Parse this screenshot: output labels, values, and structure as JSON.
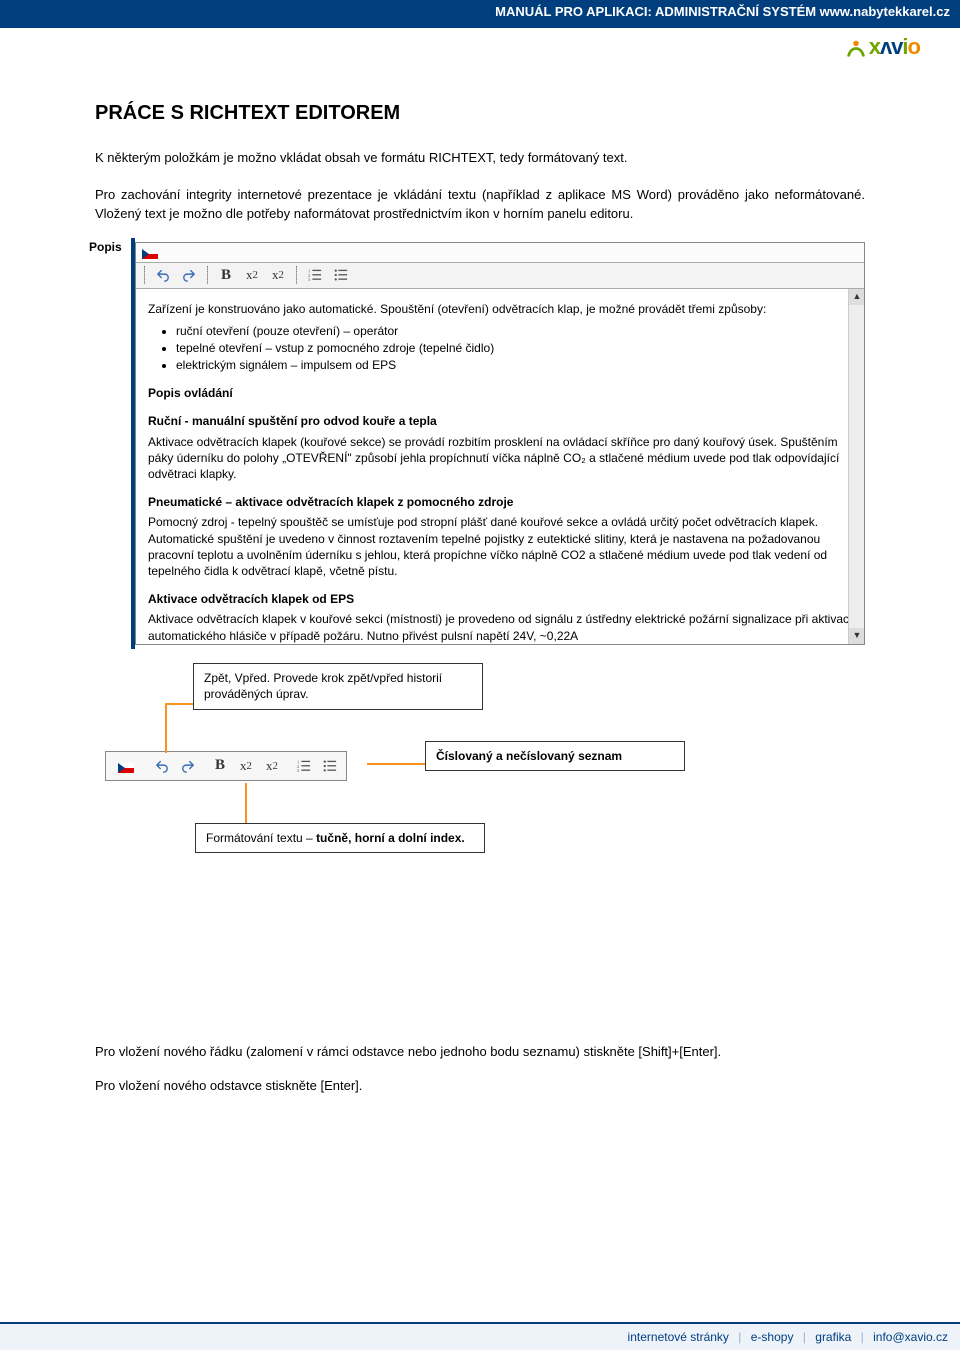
{
  "header": {
    "prefix": "MANUÁL PRO APLIKACI:",
    "title": "ADMINISTRAČNÍ SYSTÉM www.nabytekkarel.cz"
  },
  "brand": "xavio",
  "h1": "PRÁCE S RICHTEXT EDITOREM",
  "intro1": "K některým položkám je možno vkládat obsah ve formátu RICHTEXT, tedy formátovaný text.",
  "intro2": "Pro zachování integrity internetové prezentace je vkládání textu (například z aplikace MS Word) prováděno jako neformátované. Vložený text je možno dle potřeby naformátovat prostřednictvím ikon v horním panelu editoru.",
  "editor": {
    "popis_label": "Popis",
    "p0": "Zařízení je konstruováno jako automatické. Spouštění (otevření) odvětracích klap, je možné provádět třemi způsoby:",
    "li1": "ruční otevření (pouze otevření) – operátor",
    "li2": "tepelné otevření – vstup z pomocného zdroje (tepelné čidlo)",
    "li3": "elektrickým signálem – impulsem od EPS",
    "h_ovl": "Popis ovládání",
    "h_rucni": "Ruční - manuální spuštění pro odvod kouře a tepla",
    "p_rucni": "Aktivace odvětracích klapek (kouřové sekce) se provádí rozbitím prosklení na ovládací skříňce pro daný kouřový úsek. Spuštěním páky úderníku do polohy „OTEVŘENÍ\" způsobí jehla propíchnutí víčka náplně CO₂ a stlačené médium uvede pod tlak odpovídající odvětraci klapky.",
    "h_pneu": "Pneumatické – aktivace odvětracích klapek z pomocného zdroje",
    "p_pneu": "Pomocný zdroj - tepelný spouštěč se umísťuje pod stropní plášť dané kouřové sekce a ovládá určitý počet odvětracích klapek. Automatické spuštění je uvedeno v činnost roztavením tepelné pojistky z eutektické slitiny, která je nastavena na požadovanou pracovní teplotu a uvolněním úderníku s jehlou, která propíchne víčko náplně CO2 a stlačené médium uvede pod tlak vedení od tepelného čidla k odvětrací klapě, včetně pístu.",
    "h_eps": "Aktivace odvětracích klapek od EPS",
    "p_eps": "Aktivace odvětracích klapek v kouřové sekci (místnosti) je provedeno od signálu z ústředny elektrické požární signalizace při aktivaci automatického hlásiče v případě požáru. Nutno přivést pulsní napětí 24V, ~0,22A"
  },
  "annot": {
    "undo": "Zpět, Vpřed. Provede krok zpět/vpřed historií prováděných úprav.",
    "lists": "Číslovaný a nečíslovaný seznam",
    "fmt_prefix": "Formátování textu – ",
    "fmt_bold": "tučně, horní a dolní index."
  },
  "note1": "Pro vložení nového řádku (zalomení v rámci odstavce nebo jednoho bodu seznamu) stiskněte [Shift]+[Enter].",
  "note2": "Pro vložení nového odstavce stiskněte [Enter].",
  "footer": {
    "f1": "internetové stránky",
    "f2": "e-shopy",
    "f3": "grafika",
    "f4": "info@xavio.cz"
  }
}
